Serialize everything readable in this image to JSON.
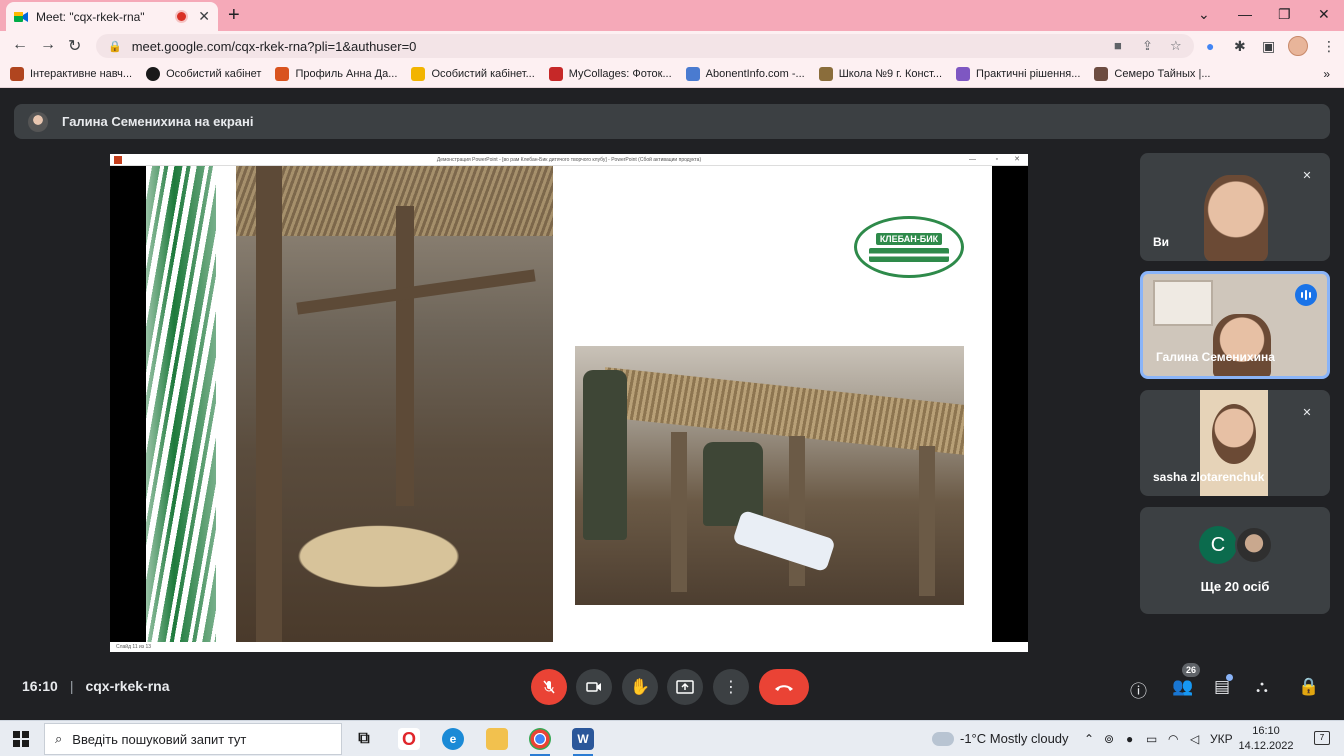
{
  "browser": {
    "tab_title": "Meet: \"cqx-rkek-rna\"",
    "new_tab_symbol": "+",
    "url": "meet.google.com/cqx-rkek-rna?pli=1&authuser=0",
    "bookmarks": [
      {
        "label": "Інтерактивне навч...",
        "color": "#b0451f"
      },
      {
        "label": "Особистий кабінет",
        "color": "#1a1a1a"
      },
      {
        "label": "Профиль Анна Да...",
        "color": "#d9531e"
      },
      {
        "label": "Особистий кабінет...",
        "color": "#f2b400"
      },
      {
        "label": "MyCollages: Фоток...",
        "color": "#c62828"
      },
      {
        "label": "AbonentInfo.com -...",
        "color": "#4a7bd0"
      },
      {
        "label": "Школа №9 г. Конст...",
        "color": "#8a6d3b"
      },
      {
        "label": "Практичні рішення...",
        "color": "#7e57c2"
      },
      {
        "label": "Семеро Тайных |...",
        "color": "#6d4c41"
      }
    ],
    "bookmarks_overflow": "»"
  },
  "meet": {
    "presenting_label": "Галина Семенихина на екрані",
    "slide": {
      "window_title": "Демонстрация PowerPoint - [во рам Клебан-Бик дитячого творчого клубу] - PowerPoint (Сбой активации продукта)",
      "logo_text": "КЛЕБАН-БИК",
      "status_text": "Слайд 11 из 13"
    },
    "participants": [
      {
        "name": "Ви",
        "muted": true,
        "speaking": false
      },
      {
        "name": "Галина Семенихина",
        "muted": false,
        "speaking": true
      },
      {
        "name": "sasha zlotarenchuk",
        "muted": true,
        "speaking": false
      }
    ],
    "others": {
      "avatar_letter": "C",
      "label": "Ще 20 осіб"
    },
    "time": "16:10",
    "code": "cqx-rkek-rna",
    "people_count": "26",
    "controls": [
      "mic-off",
      "camera",
      "raise-hand",
      "present",
      "more",
      "end-call"
    ]
  },
  "taskbar": {
    "search_placeholder": "Введіть пошуковий запит тут",
    "weather_temp": "-1°C",
    "weather_text": "Mostly cloudy",
    "lang": "УКР",
    "time": "16:10",
    "date": "14.12.2022",
    "notifications": "7"
  }
}
